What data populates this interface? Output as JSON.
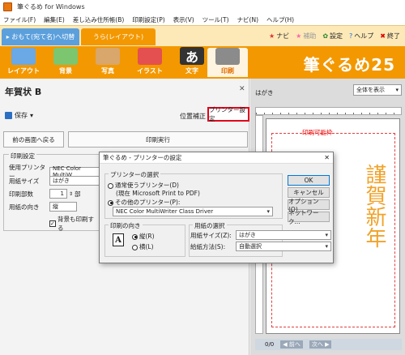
{
  "window": {
    "title": "筆ぐるめ for Windows"
  },
  "menu": [
    "ファイル(F)",
    "編集(E)",
    "差し込み住所帳(B)",
    "印刷設定(P)",
    "表示(V)",
    "ツール(T)",
    "ナビ(N)",
    "ヘルプ(H)"
  ],
  "top_tabs": {
    "omote": "おもて(宛て名)へ切替",
    "ura": "うら(レイアウト)"
  },
  "top_links": {
    "navi": "ナビ",
    "hojo": "補助",
    "settei": "設定",
    "help": "ヘルプ",
    "close": "終了"
  },
  "ribbon": {
    "items": [
      "レイアウト",
      "背景",
      "写真",
      "イラスト",
      "文字",
      "印刷"
    ],
    "active": "印刷",
    "brand": "筆ぐるめ25"
  },
  "left": {
    "doc_title": "年賀状 B",
    "save_label": "保存",
    "pos_label": "位置補正",
    "printer_btn": "プリンター設定",
    "back_btn": "前の画面へ戻る",
    "exec_btn": "印刷実行",
    "settings": {
      "legend": "印刷設定",
      "printer_label": "使用プリンター",
      "printer_value": "NEC Color MultiW",
      "size_label": "用紙サイズ",
      "size_value": "はがき",
      "copies_label": "印刷部数",
      "copies_value": "1",
      "copies_unit": "部",
      "orient_label": "用紙の向き",
      "orient_value": "縦",
      "bg_print": "背景も印刷する"
    }
  },
  "right": {
    "paper_label": "はがき",
    "zoom_value": "全体を表示",
    "printable": "印刷可能枠",
    "vertical_text": "謹賀新年",
    "page_counter": "0/0",
    "nav_prev": "前へ",
    "nav_next": "次へ"
  },
  "dialog": {
    "title": "筆ぐるめ - プリンターの設定",
    "printer_group": "プリンターの選択",
    "normal_printer": "通常使うプリンター(D)",
    "normal_printer_sub": "(現在 Microsoft Print to PDF)",
    "other_printer": "その他のプリンター(P):",
    "other_printer_value": "NEC Color MultiWriter Class Driver",
    "orient_group": "印刷の向き",
    "portrait": "縦(R)",
    "landscape": "横(L)",
    "paper_group": "用紙の選択",
    "paper_size_label": "用紙サイズ(Z):",
    "paper_size_value": "はがき",
    "paper_feed_label": "給紙方法(S):",
    "paper_feed_value": "自動選択",
    "ok": "OK",
    "cancel": "キャンセル",
    "options": "オプション(O)...",
    "network": "ネットワーク..."
  }
}
